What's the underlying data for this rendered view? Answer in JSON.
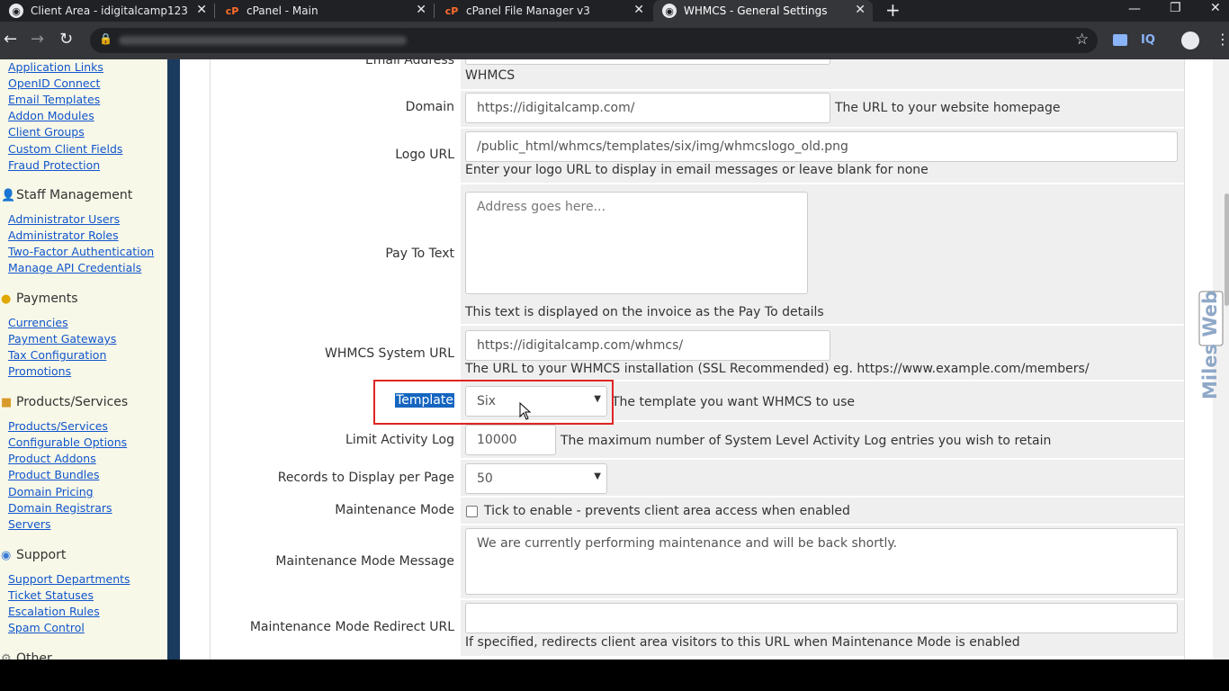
{
  "browser": {
    "tabs": [
      {
        "title": "Client Area - idigitalcamp123",
        "icon": "globe-icon",
        "active": false
      },
      {
        "title": "cPanel - Main",
        "icon": "cpanel-icon",
        "active": false
      },
      {
        "title": "cPanel File Manager v3",
        "icon": "cpanel-icon",
        "active": false
      },
      {
        "title": "WHMCS - General Settings",
        "icon": "globe-icon",
        "active": true
      }
    ],
    "new_tab": "+",
    "extension_label": "IQ"
  },
  "sidebar": {
    "top_links": [
      "Application Links",
      "OpenID Connect",
      "Email Templates",
      "Addon Modules",
      "Client Groups",
      "Custom Client Fields",
      "Fraud Protection"
    ],
    "sections": [
      {
        "title": "Staff Management",
        "icon": "user-icon",
        "links": [
          "Administrator Users",
          "Administrator Roles",
          "Two-Factor Authentication",
          "Manage API Credentials"
        ]
      },
      {
        "title": "Payments",
        "icon": "coins-icon",
        "links": [
          "Currencies",
          "Payment Gateways",
          "Tax Configuration",
          "Promotions"
        ]
      },
      {
        "title": "Products/Services",
        "icon": "box-icon",
        "links": [
          "Products/Services",
          "Configurable Options",
          "Product Addons",
          "Product Bundles",
          "Domain Pricing",
          "Domain Registrars",
          "Servers"
        ]
      },
      {
        "title": "Support",
        "icon": "support-icon",
        "links": [
          "Support Departments",
          "Ticket Statuses",
          "Escalation Rules",
          "Spam Control"
        ]
      },
      {
        "title": "Other",
        "icon": "gear-icon",
        "links": []
      }
    ]
  },
  "form": {
    "email_address": {
      "label": "Email Address",
      "value": "WHMCS"
    },
    "domain": {
      "label": "Domain",
      "value": "https://idigitalcamp.com/",
      "help": "The URL to your website homepage"
    },
    "logo_url": {
      "label": "Logo URL",
      "value": "/public_html/whmcs/templates/six/img/whmcslogo_old.png",
      "help": "Enter your logo URL to display in email messages or leave blank for none"
    },
    "pay_to_text": {
      "label": "Pay To Text",
      "placeholder": "Address goes here...",
      "help": "This text is displayed on the invoice as the Pay To details"
    },
    "system_url": {
      "label": "WHMCS System URL",
      "value": "https://idigitalcamp.com/whmcs/",
      "help": "The URL to your WHMCS installation (SSL Recommended) eg. https://www.example.com/members/"
    },
    "template": {
      "label": "Template",
      "value": "Six",
      "help": "The template you want WHMCS to use"
    },
    "activity_log": {
      "label": "Limit Activity Log",
      "value": "10000",
      "help": "The maximum number of System Level Activity Log entries you wish to retain"
    },
    "records_per_page": {
      "label": "Records to Display per Page",
      "value": "50"
    },
    "maintenance_mode": {
      "label": "Maintenance Mode",
      "help": "Tick to enable - prevents client area access when enabled",
      "checked": false
    },
    "maintenance_message": {
      "label": "Maintenance Mode Message",
      "value": "We are currently performing maintenance and will be back shortly."
    },
    "maintenance_redirect": {
      "label": "Maintenance Mode Redirect URL",
      "value": "",
      "help": "If specified, redirects client area visitors to this URL when Maintenance Mode is enabled"
    }
  },
  "watermark": "Miles Web",
  "colors": {
    "link": "#1155cc",
    "highlight": "#e02424",
    "selection": "#1565c0"
  }
}
